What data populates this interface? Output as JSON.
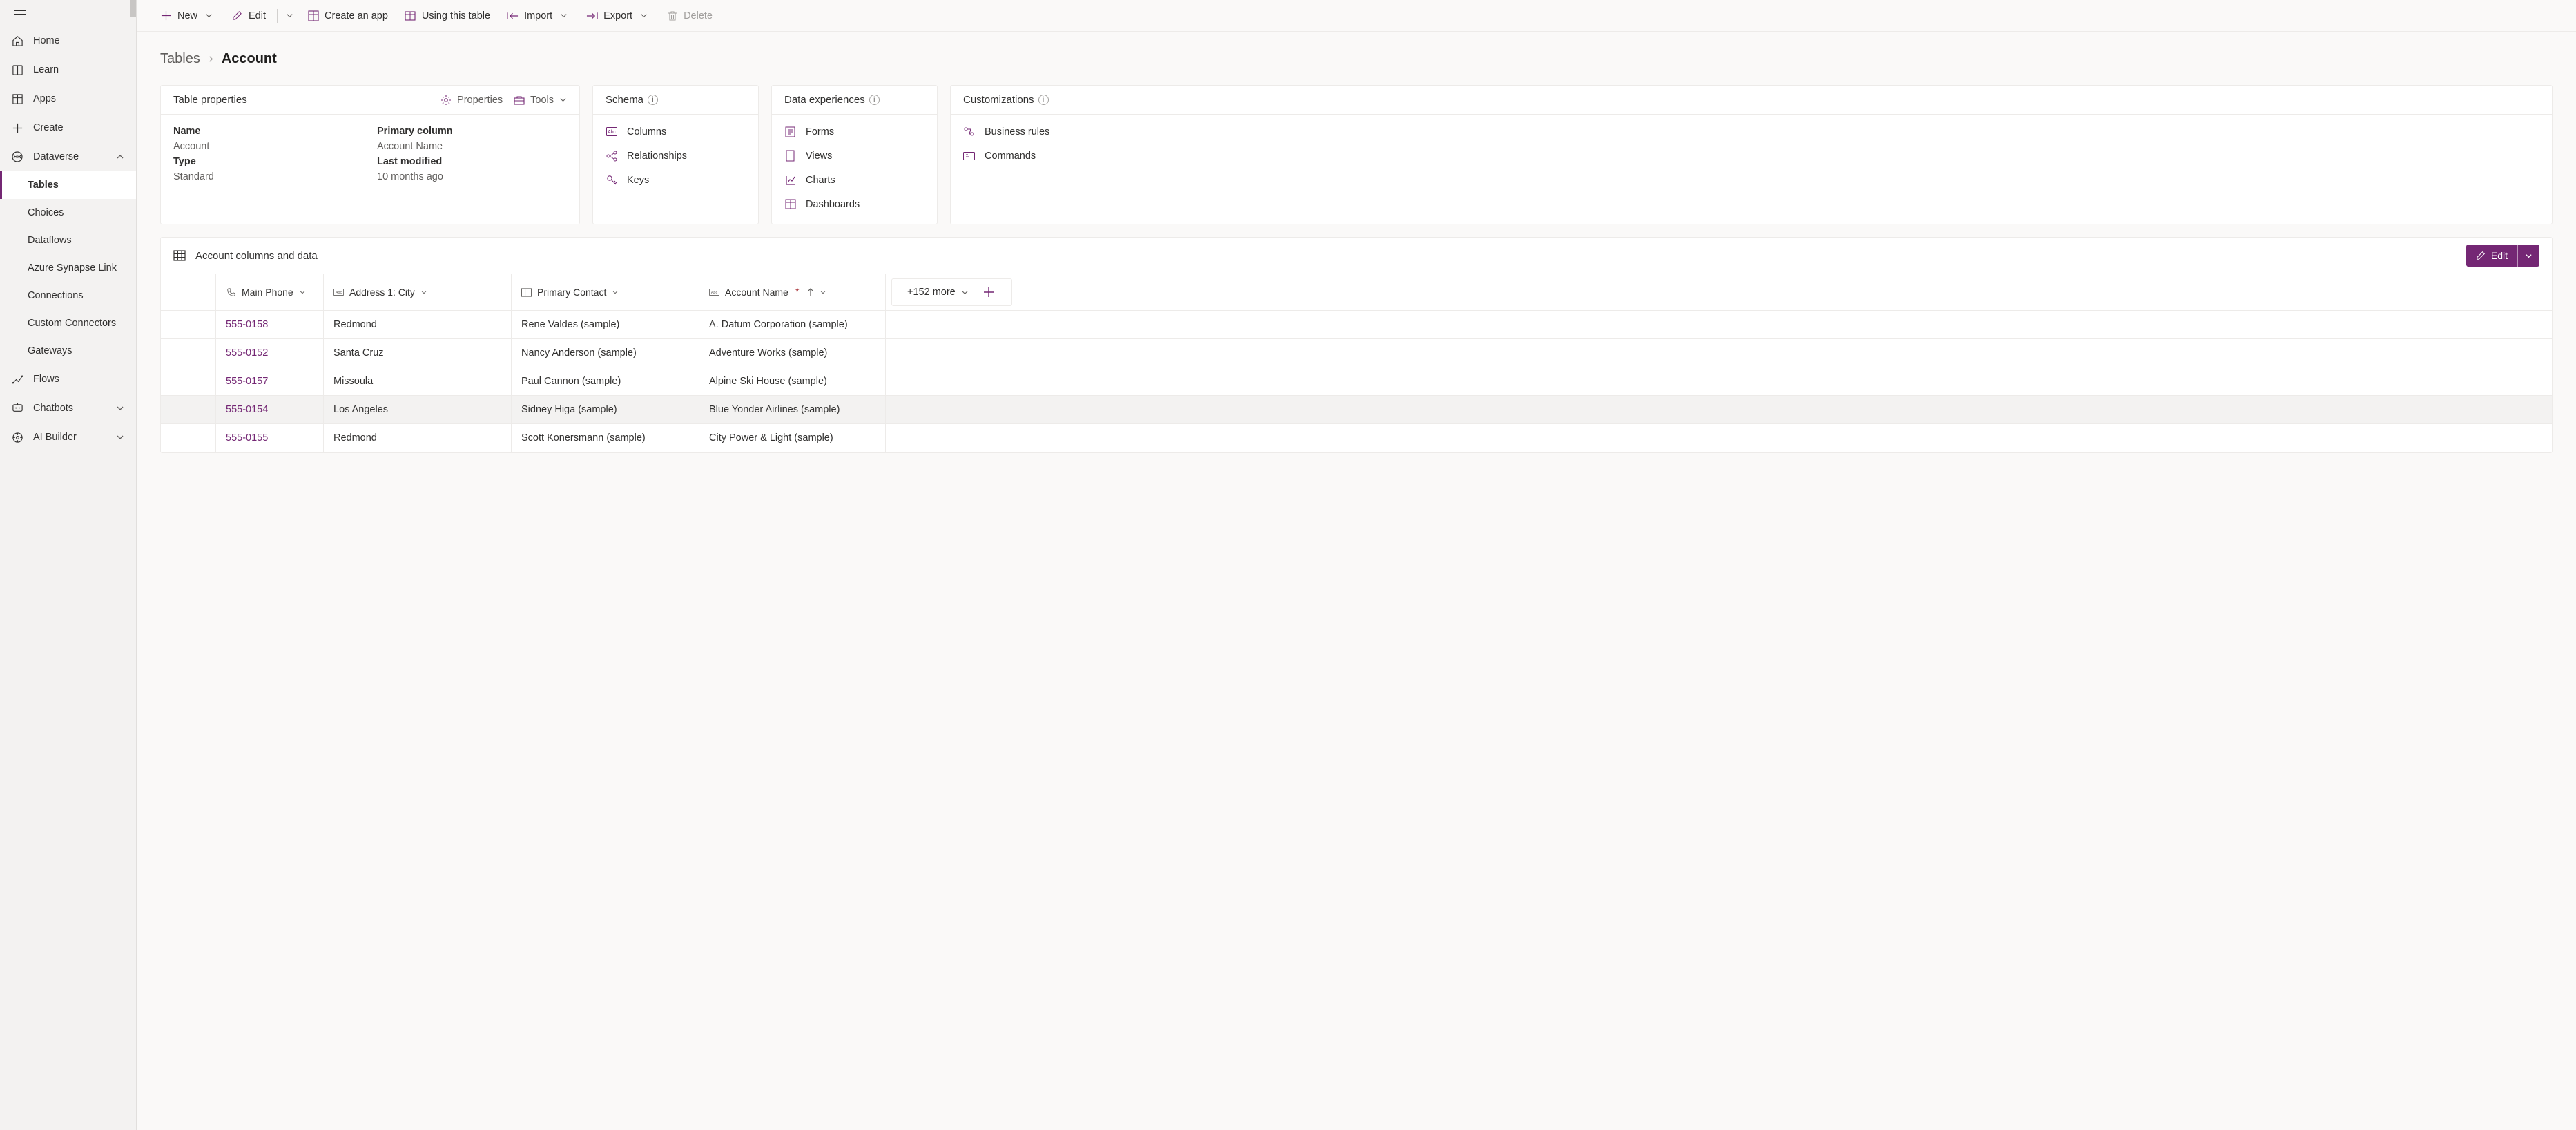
{
  "sidebar": {
    "items": [
      {
        "label": "Home",
        "indent": false,
        "icon": "home"
      },
      {
        "label": "Learn",
        "indent": false,
        "icon": "learn"
      },
      {
        "label": "Apps",
        "indent": false,
        "icon": "apps"
      },
      {
        "label": "Create",
        "indent": false,
        "icon": "plus"
      },
      {
        "label": "Dataverse",
        "indent": false,
        "icon": "dataverse",
        "expandable": true,
        "expanded": true
      },
      {
        "label": "Tables",
        "indent": true,
        "active": true
      },
      {
        "label": "Choices",
        "indent": true
      },
      {
        "label": "Dataflows",
        "indent": true
      },
      {
        "label": "Azure Synapse Link",
        "indent": true
      },
      {
        "label": "Connections",
        "indent": true
      },
      {
        "label": "Custom Connectors",
        "indent": true
      },
      {
        "label": "Gateways",
        "indent": true
      },
      {
        "label": "Flows",
        "indent": false,
        "icon": "flows"
      },
      {
        "label": "Chatbots",
        "indent": false,
        "icon": "chatbots",
        "expandable": true
      },
      {
        "label": "AI Builder",
        "indent": false,
        "icon": "aibuilder",
        "expandable": true
      }
    ]
  },
  "commandbar": {
    "new": "New",
    "edit": "Edit",
    "createApp": "Create an app",
    "usingTable": "Using this table",
    "import": "Import",
    "export": "Export",
    "delete": "Delete"
  },
  "breadcrumb": {
    "root": "Tables",
    "current": "Account"
  },
  "cards": {
    "tableProperties": {
      "title": "Table properties",
      "propertiesAction": "Properties",
      "toolsAction": "Tools",
      "labels": {
        "name": "Name",
        "type": "Type",
        "primaryColumn": "Primary column",
        "lastModified": "Last modified"
      },
      "values": {
        "name": "Account",
        "type": "Standard",
        "primaryColumn": "Account Name",
        "lastModified": "10 months ago"
      }
    },
    "schema": {
      "title": "Schema",
      "items": [
        "Columns",
        "Relationships",
        "Keys"
      ]
    },
    "dataExperiences": {
      "title": "Data experiences",
      "items": [
        "Forms",
        "Views",
        "Charts",
        "Dashboards"
      ]
    },
    "customizations": {
      "title": "Customizations",
      "items": [
        "Business rules",
        "Commands"
      ]
    }
  },
  "dataSection": {
    "title": "Account columns and data",
    "editLabel": "Edit",
    "moreColumns": "+152 more",
    "columns": [
      {
        "key": "phone",
        "label": "Main Phone",
        "icon": "phone"
      },
      {
        "key": "city",
        "label": "Address 1: City",
        "icon": "abc"
      },
      {
        "key": "contact",
        "label": "Primary Contact",
        "icon": "lookup"
      },
      {
        "key": "name",
        "label": "Account Name",
        "icon": "abc",
        "required": true,
        "sort": "asc"
      }
    ],
    "rows": [
      {
        "phone": "555-0158",
        "city": "Redmond",
        "contact": "Rene Valdes (sample)",
        "name": "A. Datum Corporation (sample)"
      },
      {
        "phone": "555-0152",
        "city": "Santa Cruz",
        "contact": "Nancy Anderson (sample)",
        "name": "Adventure Works (sample)"
      },
      {
        "phone": "555-0157",
        "city": "Missoula",
        "contact": "Paul Cannon (sample)",
        "name": "Alpine Ski House (sample)",
        "phoneUnderline": true
      },
      {
        "phone": "555-0154",
        "city": "Los Angeles",
        "contact": "Sidney Higa (sample)",
        "name": "Blue Yonder Airlines (sample)",
        "hover": true
      },
      {
        "phone": "555-0155",
        "city": "Redmond",
        "contact": "Scott Konersmann (sample)",
        "name": "City Power & Light (sample)"
      }
    ]
  },
  "colors": {
    "accent": "#742774"
  }
}
